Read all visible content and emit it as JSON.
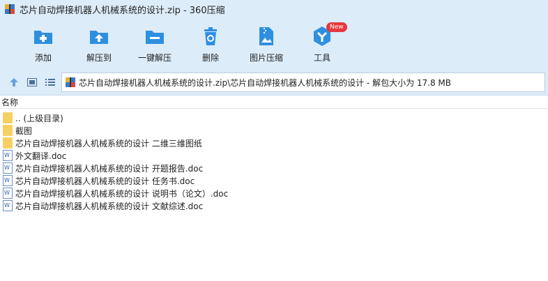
{
  "window": {
    "title": "芯片自动焊接机器人机械系统的设计.zip - 360压缩"
  },
  "toolbar": {
    "items": [
      {
        "label": "添加",
        "icon": "add-icon"
      },
      {
        "label": "解压到",
        "icon": "extract-to-icon"
      },
      {
        "label": "一键解压",
        "icon": "one-click-extract-icon"
      },
      {
        "label": "删除",
        "icon": "delete-icon"
      },
      {
        "label": "图片压缩",
        "icon": "image-compress-icon"
      },
      {
        "label": "工具",
        "icon": "tools-icon",
        "badge": "New"
      }
    ],
    "accent": "#2e8fe0",
    "badge_color": "#e8383d"
  },
  "addressbar": {
    "path": "芯片自动焊接机器人机械系统的设计.zip\\芯片自动焊接机器人机械系统的设计 - 解包大小为 17.8 MB"
  },
  "filelist": {
    "header_name": "名称",
    "rows": [
      {
        "name": ".. (上级目录)",
        "type": "folder"
      },
      {
        "name": "截图",
        "type": "folder"
      },
      {
        "name": "芯片自动焊接机器人机械系统的设计 二维三维图纸",
        "type": "folder"
      },
      {
        "name": "外文翻译.doc",
        "type": "doc"
      },
      {
        "name": "芯片自动焊接机器人机械系统的设计 开题报告.doc",
        "type": "doc"
      },
      {
        "name": "芯片自动焊接机器人机械系统的设计 任务书.doc",
        "type": "doc"
      },
      {
        "name": "芯片自动焊接机器人机械系统的设计 说明书（论文）.doc",
        "type": "doc"
      },
      {
        "name": "芯片自动焊接机器人机械系统的设计 文献综述.doc",
        "type": "doc"
      }
    ]
  }
}
